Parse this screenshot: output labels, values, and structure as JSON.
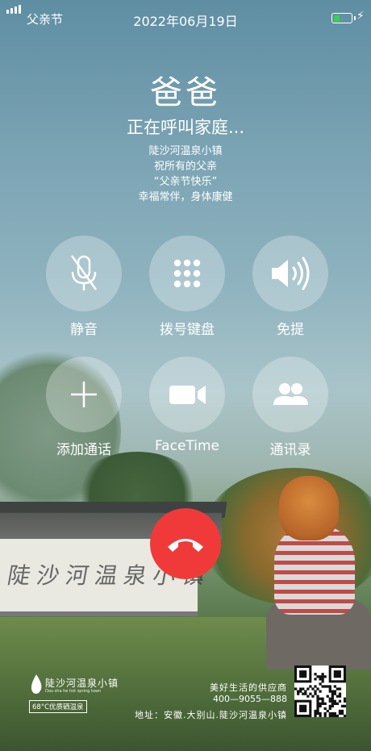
{
  "status_bar": {
    "carrier": "父亲节",
    "datetime": "2022年06月19日",
    "battery_level": 0.35,
    "battery_color": "#36d24a"
  },
  "call": {
    "caller_name": "爸爸",
    "status": "正在呼叫家庭...",
    "message": [
      "陡沙河温泉小镇",
      "祝所有的父亲",
      "“父亲节快乐”",
      "幸福常伴，身体康健"
    ]
  },
  "buttons": [
    {
      "label": "静音",
      "icon": "mic-muted-icon"
    },
    {
      "label": "拨号键盘",
      "icon": "keypad-icon"
    },
    {
      "label": "免提",
      "icon": "speaker-icon"
    },
    {
      "label": "添加通话",
      "icon": "plus-icon"
    },
    {
      "label": "FaceTime",
      "icon": "video-camera-icon"
    },
    {
      "label": "通讯录",
      "icon": "contacts-icon"
    }
  ],
  "end_call": {
    "icon": "hang-up-icon",
    "color": "#f03a3a"
  },
  "footer": {
    "brand_name": "陡沙河温泉小镇",
    "brand_subtitle": "Dou sha he hot spring town",
    "badge": "68°C优质硒温泉",
    "slogan": "美好生活的供应商",
    "phone": "400—9055—888",
    "address": "地址：安徽.大别山.陡沙河温泉小镇",
    "qr_icon": "qr-code-icon"
  }
}
